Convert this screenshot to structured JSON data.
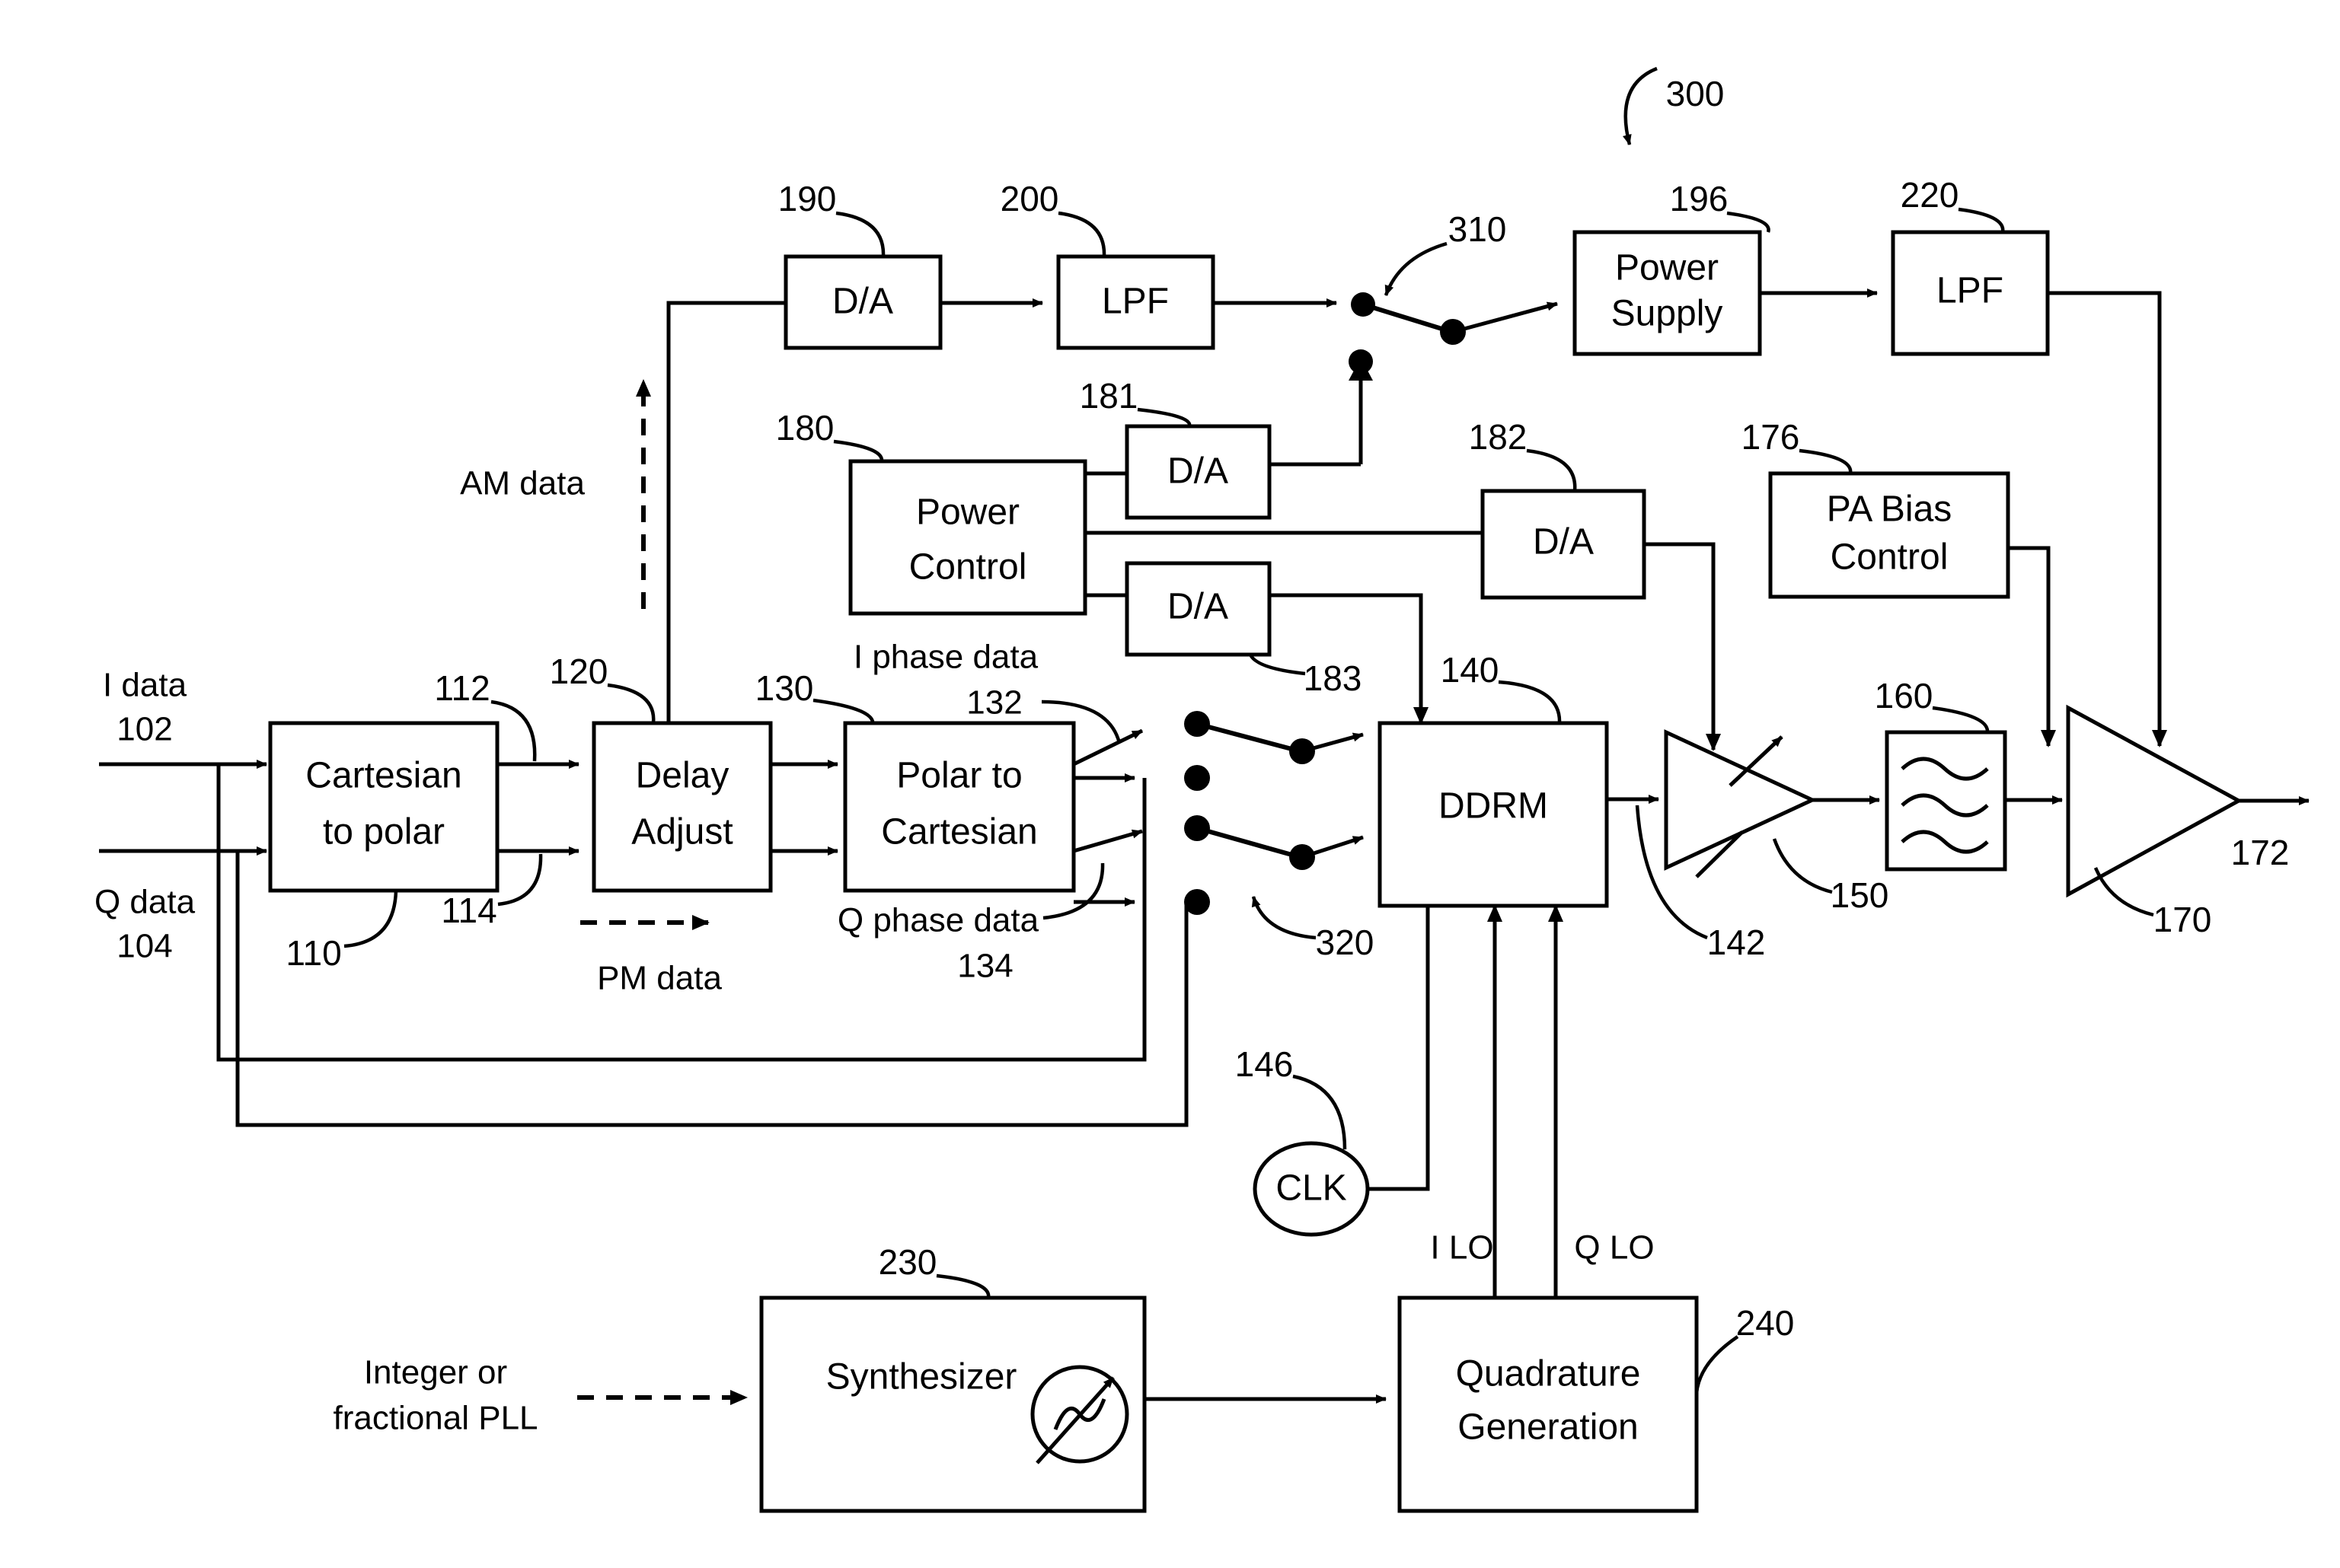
{
  "figure": {
    "type": "patent-block-diagram",
    "overall_ref": "300"
  },
  "blocks": {
    "cartesian_to_polar": {
      "line1": "Cartesian",
      "line2": "to polar",
      "ref": "110"
    },
    "delay_adjust": {
      "line1": "Delay",
      "line2": "Adjust",
      "ref": "120"
    },
    "polar_to_cartesian": {
      "line1": "Polar to",
      "line2": "Cartesian",
      "ref": "130"
    },
    "ddrm": {
      "label": "DDRM",
      "ref": "140"
    },
    "da_am": {
      "label": "D/A",
      "ref": "190"
    },
    "lpf_am": {
      "label": "LPF",
      "ref": "200"
    },
    "power_supply": {
      "line1": "Power",
      "line2": "Supply",
      "ref": "196"
    },
    "lpf_supply": {
      "label": "LPF",
      "ref": "220"
    },
    "power_control": {
      "line1": "Power",
      "line2": "Control",
      "ref": "180"
    },
    "da_181": {
      "label": "D/A",
      "ref": "181"
    },
    "da_182": {
      "label": "D/A",
      "ref": "182"
    },
    "da_183": {
      "label": "D/A",
      "ref": "183"
    },
    "pa_bias_control": {
      "line1": "PA Bias",
      "line2": "Control",
      "ref": "176"
    },
    "vga": {
      "ref": "150"
    },
    "bandpass_filter": {
      "ref": "160"
    },
    "power_amplifier": {
      "ref": "170"
    },
    "synthesizer": {
      "label": "Synthesizer",
      "ref": "230"
    },
    "quadrature_generation": {
      "line1": "Quadrature",
      "line2": "Generation",
      "ref": "240"
    },
    "clk": {
      "label": "CLK",
      "ref": "146"
    }
  },
  "signals": {
    "i_data": {
      "line1": "I data",
      "line2": "102"
    },
    "q_data": {
      "line1": "Q data",
      "line2": "104"
    },
    "am_data": {
      "label": "AM data"
    },
    "pm_data": {
      "label": "PM data"
    },
    "i_phase_data": {
      "line1": "I phase data",
      "line2": "132"
    },
    "q_phase_data": {
      "line1": "Q phase data",
      "line2": "134"
    },
    "i_lo": {
      "label": "I LO"
    },
    "q_lo": {
      "label": "Q LO"
    },
    "pll_input": {
      "line1": "Integer or",
      "line2": "fractional PLL"
    },
    "rf_out": {
      "label": "172"
    },
    "ddrm_out": {
      "label": "142"
    },
    "cp_out_i": {
      "label": "112"
    },
    "cp_out_q": {
      "label": "114"
    }
  },
  "switches": {
    "supply_switch": {
      "ref": "310"
    },
    "baseband_switch": {
      "ref": "320"
    }
  },
  "reference_numerals": [
    "300",
    "310",
    "320",
    "190",
    "200",
    "196",
    "220",
    "180",
    "181",
    "182",
    "183",
    "176",
    "110",
    "112",
    "114",
    "120",
    "130",
    "132",
    "134",
    "140",
    "142",
    "146",
    "150",
    "160",
    "170",
    "172",
    "102",
    "104",
    "230",
    "240"
  ]
}
